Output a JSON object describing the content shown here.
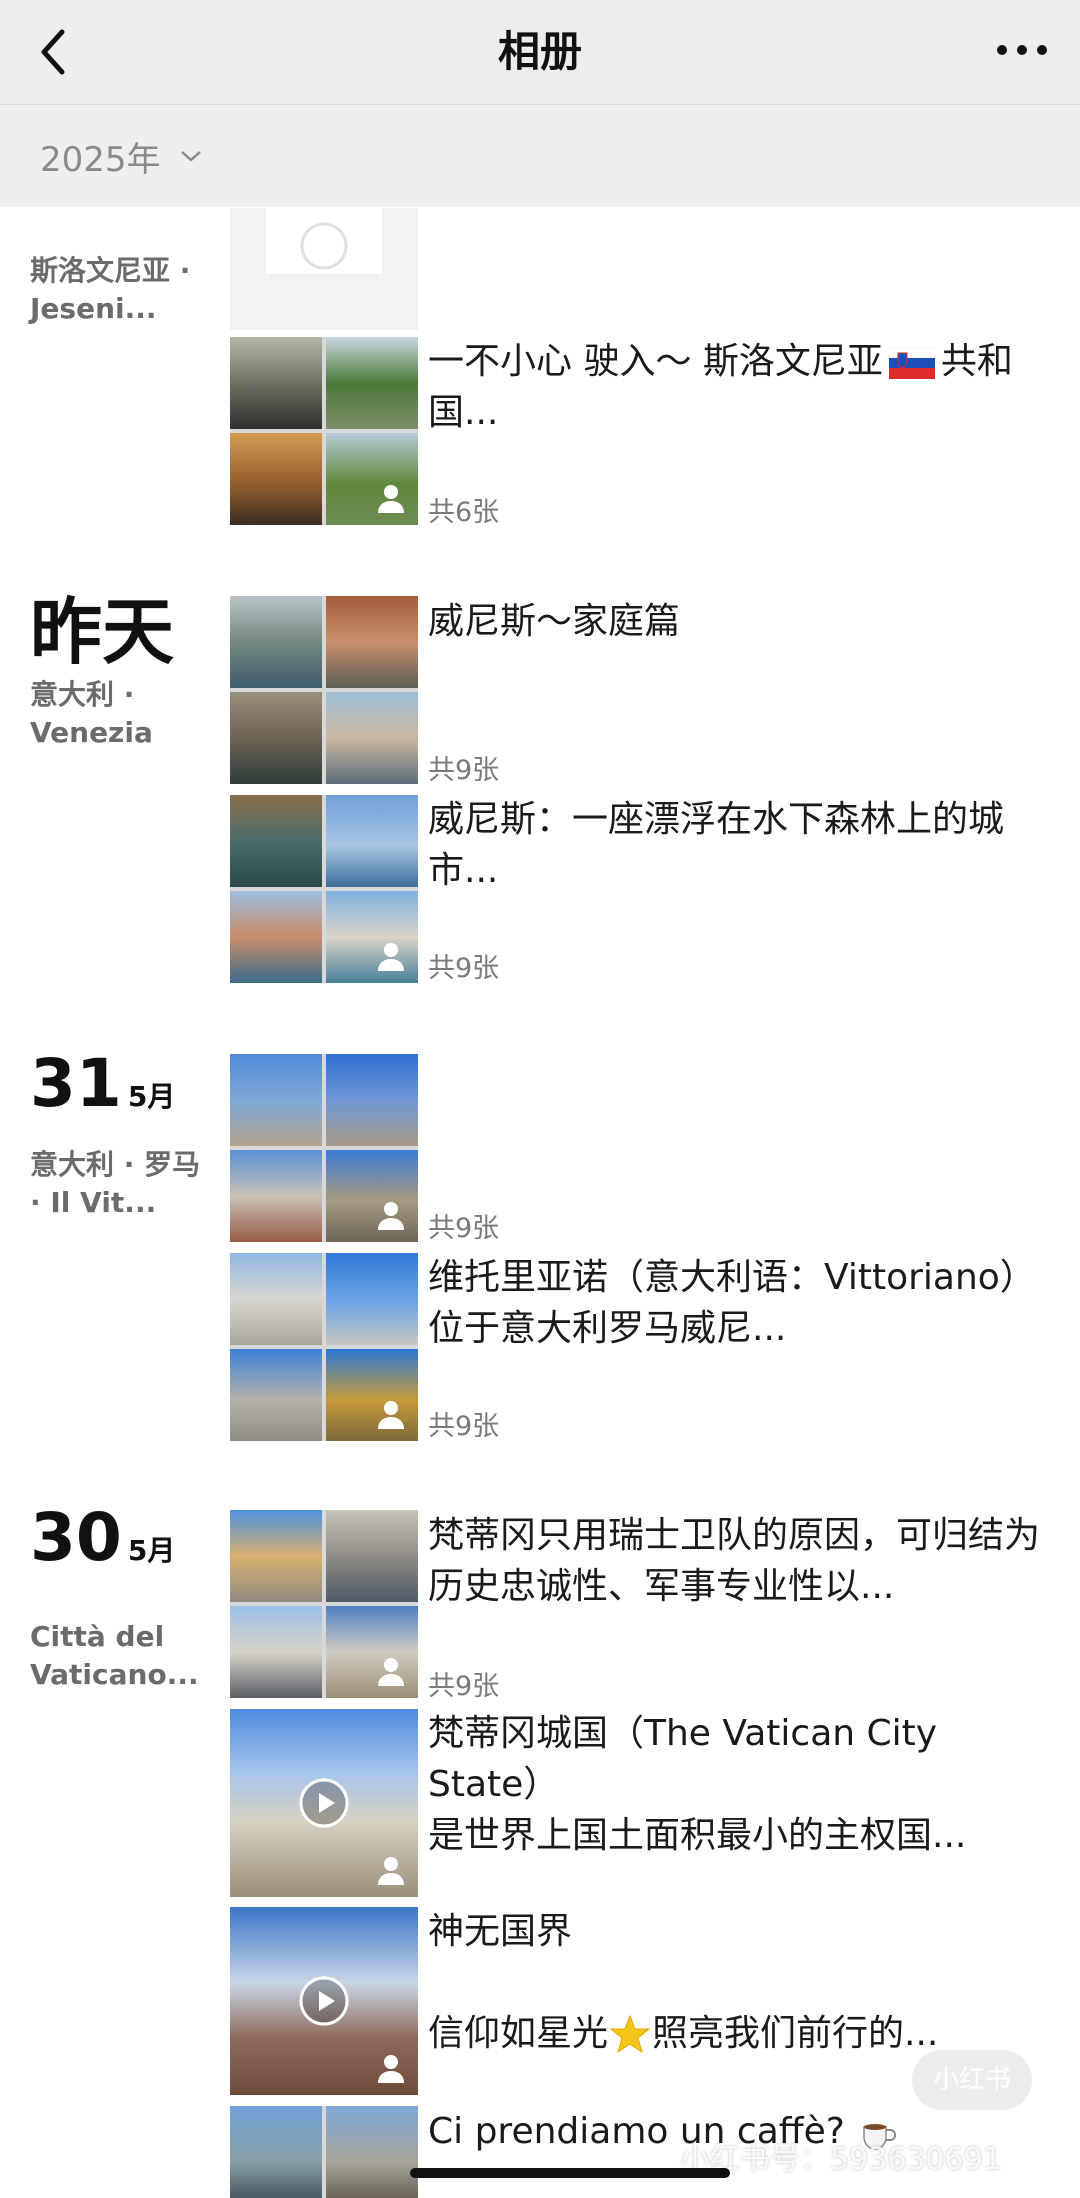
{
  "header": {
    "title": "相册"
  },
  "year_filter": {
    "label": "2025年"
  },
  "colors": {
    "nav_bg": "#ededed",
    "year_bg": "#efefef",
    "place_text": "#6b6b6b",
    "count_text": "#7a7a7a"
  },
  "groups": [
    {
      "place": "斯洛文尼亚 · Jeseni...",
      "posts": [
        {
          "text_a": "一不小心 驶入～ 斯洛文尼亚",
          "flag": "slovenia-flag",
          "text_b": "共和国...",
          "count": "共6张"
        }
      ]
    },
    {
      "day": "昨天",
      "place": "意大利 · Venezia",
      "posts": [
        {
          "text": "威尼斯～家庭篇",
          "count": "共9张"
        },
        {
          "text": "威尼斯：一座漂浮在水下森林上的城市...",
          "count": "共9张"
        }
      ]
    },
    {
      "day": "31",
      "month": "5月",
      "place": "意大利 · 罗马 · Il Vit...",
      "posts": [
        {
          "text": "",
          "count": "共9张"
        },
        {
          "text": "维托里亚诺（意大利语：Vittoriano）位于意大利罗马威尼...",
          "count": "共9张"
        }
      ]
    },
    {
      "day": "30",
      "month": "5月",
      "place": "Città del Vaticano...",
      "posts": [
        {
          "text": "梵蒂冈只用瑞士卫队的原因，可归结为历史忠诚性、军事专业性以...",
          "count": "共9张"
        },
        {
          "text_a": "梵蒂冈城国（The Vatican City State）",
          "text_b": "是世界上国土面积最小的主权国..."
        },
        {
          "text_a": "神无国界",
          "text_b": "信仰如星光",
          "emoji": "star-icon",
          "text_c": "照亮我们前行的..."
        },
        {
          "text": "Ci prendiamo un caffè?",
          "emoji": "coffee-icon"
        }
      ]
    }
  ],
  "watermark": {
    "logo": "小红书",
    "text": "小红书号：593630691"
  }
}
